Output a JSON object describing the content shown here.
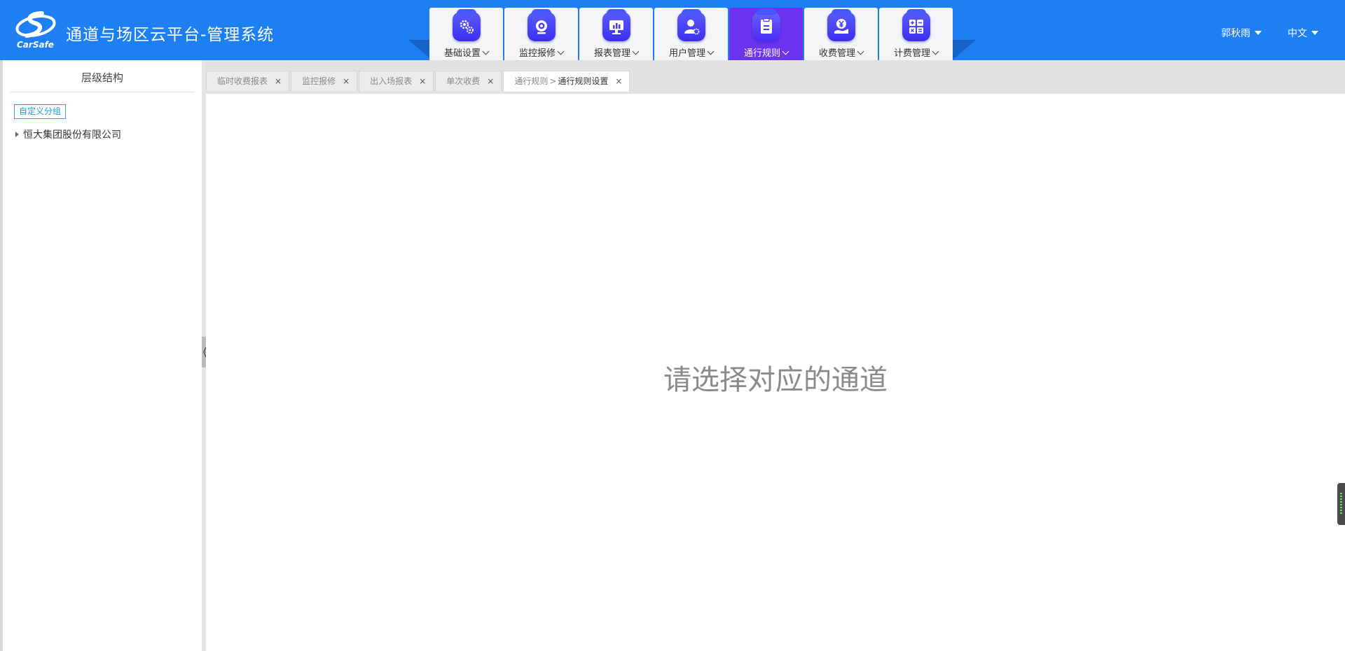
{
  "header": {
    "logo_text": "CarSafe",
    "title": "通道与场区云平台-管理系统",
    "user_name": "郭秋雨",
    "language": "中文"
  },
  "nav": {
    "items": [
      {
        "label": "基础设置",
        "icon": "gears-icon"
      },
      {
        "label": "监控报修",
        "icon": "camera-icon"
      },
      {
        "label": "报表管理",
        "icon": "report-chart-icon"
      },
      {
        "label": "用户管理",
        "icon": "user-settings-icon"
      },
      {
        "label": "通行规则",
        "icon": "rule-document-icon",
        "active": true
      },
      {
        "label": "收费管理",
        "icon": "payment-hand-icon"
      },
      {
        "label": "计费管理",
        "icon": "calculator-icon"
      }
    ]
  },
  "sidebar": {
    "title": "层级结构",
    "custom_group_label": "自定义分组",
    "tree": [
      {
        "label": "恒大集团股份有限公司",
        "expanded": false
      }
    ]
  },
  "tabs": [
    {
      "label": "临时收费报表"
    },
    {
      "label": "监控报修"
    },
    {
      "label": "出入场报表"
    },
    {
      "label": "单次收费"
    },
    {
      "parent": "通行规则",
      "separator": ">",
      "label": "通行规则设置",
      "active": true
    }
  ],
  "tab_close_symbol": "×",
  "content": {
    "empty_message": "请选择对应的通道"
  },
  "colors": {
    "header_bg": "#1d7ff2",
    "active_nav_bg": "#6c34f0",
    "icon_gradient": "#3b2ff0",
    "group_button_border": "#24a9d9"
  }
}
